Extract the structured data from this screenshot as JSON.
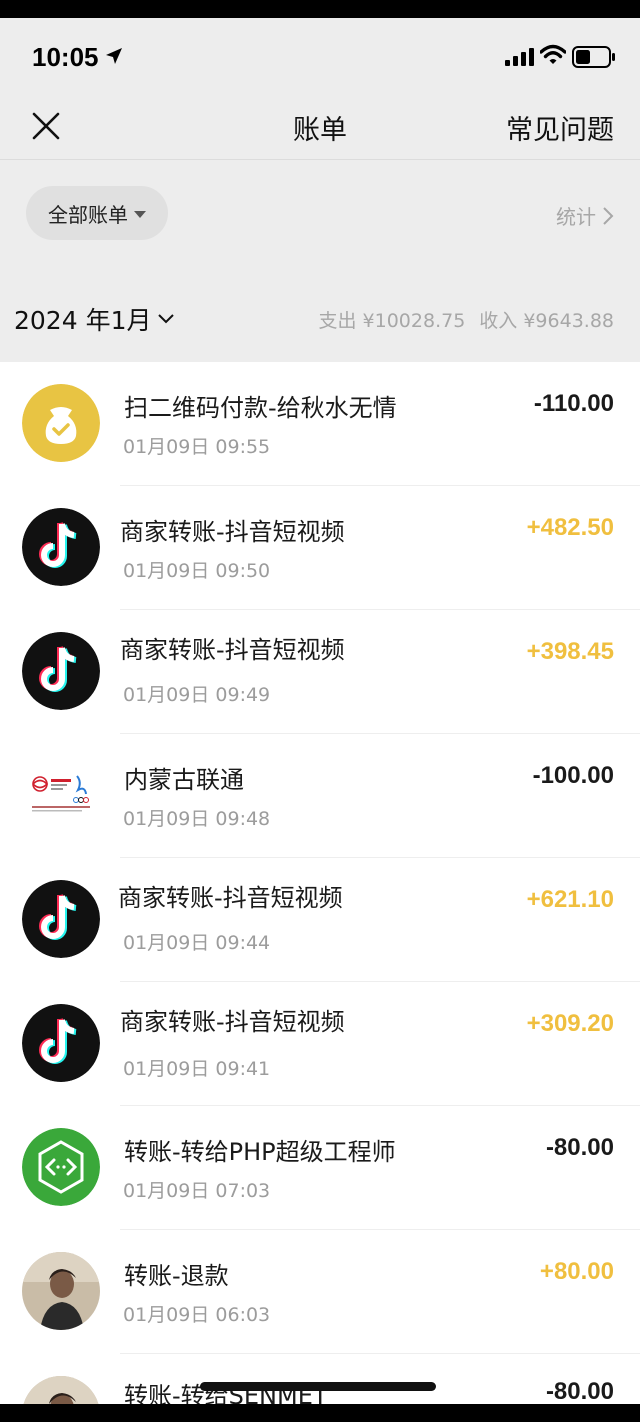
{
  "status": {
    "time": "10:05"
  },
  "nav": {
    "title": "账单",
    "faq": "常见问题"
  },
  "filter": {
    "label": "全部账单",
    "stats": "统计"
  },
  "month": {
    "label": "2024 年1月",
    "expense": "支出 ¥10028.75",
    "income": "收入 ¥9643.88"
  },
  "colors": {
    "income": "#f0bf3f",
    "expense": "#1a1a1a",
    "tiktok": "#000000",
    "unicom_red": "#d0202e",
    "green_php": "#3aa83a"
  },
  "transactions": [
    {
      "title": "扫二维码付款-给秋水无情",
      "time": "01月09日 09:55",
      "amount": "-110.00",
      "icon": "money-bag-icon"
    },
    {
      "title": "商家转账-抖音短视频",
      "time": "01月09日 09:50",
      "amount": "+482.50",
      "icon": "tiktok-icon"
    },
    {
      "title": "商家转账-抖音短视频",
      "time": "01月09日 09:49",
      "amount": "+398.45",
      "icon": "tiktok-icon"
    },
    {
      "title": "内蒙古联通",
      "time": "01月09日 09:48",
      "amount": "-100.00",
      "icon": "china-unicom-logo"
    },
    {
      "title": "商家转账-抖音短视频",
      "time": "01月09日 09:44",
      "amount": "+621.10",
      "icon": "tiktok-icon"
    },
    {
      "title": "商家转账-抖音短视频",
      "time": "01月09日 09:41",
      "amount": "+309.20",
      "icon": "tiktok-icon"
    },
    {
      "title": "转账-转给PHP超级工程师",
      "time": "01月09日 07:03",
      "amount": "-80.00",
      "icon": "code-hexagon-avatar"
    },
    {
      "title": "转账-退款",
      "time": "01月09日 06:03",
      "amount": "+80.00",
      "icon": "person-photo-avatar"
    },
    {
      "title": "转账-转给SENMET",
      "time": "",
      "amount": "-80.00",
      "icon": "person-photo-avatar"
    }
  ]
}
